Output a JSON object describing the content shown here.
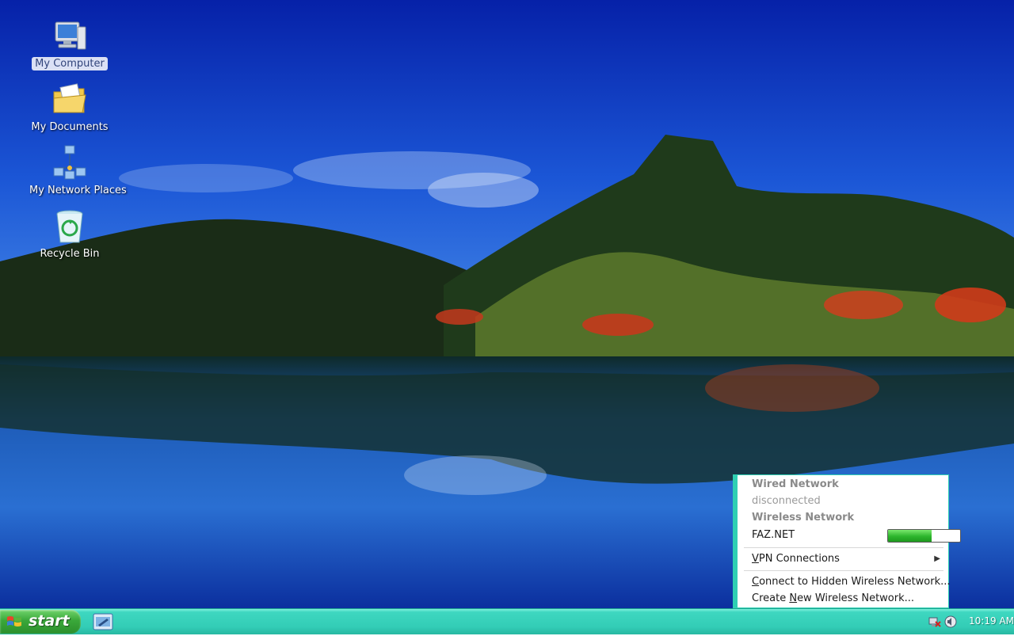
{
  "desktop": {
    "icons": [
      {
        "label": "My Computer",
        "icon": "computer-icon",
        "selected": true
      },
      {
        "label": "My Documents",
        "icon": "documents-folder-icon",
        "selected": false
      },
      {
        "label": "My Network Places",
        "icon": "network-places-icon",
        "selected": false
      },
      {
        "label": "Recycle Bin",
        "icon": "recycle-bin-icon",
        "selected": false
      }
    ]
  },
  "network_menu": {
    "wired_header": "Wired Network",
    "wired_status": "disconnected",
    "wireless_header": "Wireless Network",
    "network_name": "FAZ.NET",
    "signal_strength_fraction": 0.6,
    "vpn_prefix": "V",
    "vpn_rest": "PN Connections",
    "hidden_prefix": "C",
    "hidden_rest": "onnect to Hidden Wireless Network...",
    "create_prefix": "Create ",
    "create_underline": "N",
    "create_rest": "ew Wireless Network..."
  },
  "taskbar": {
    "start_label": "start",
    "clock": "10:19 AM",
    "accent": "#33cdb6"
  }
}
